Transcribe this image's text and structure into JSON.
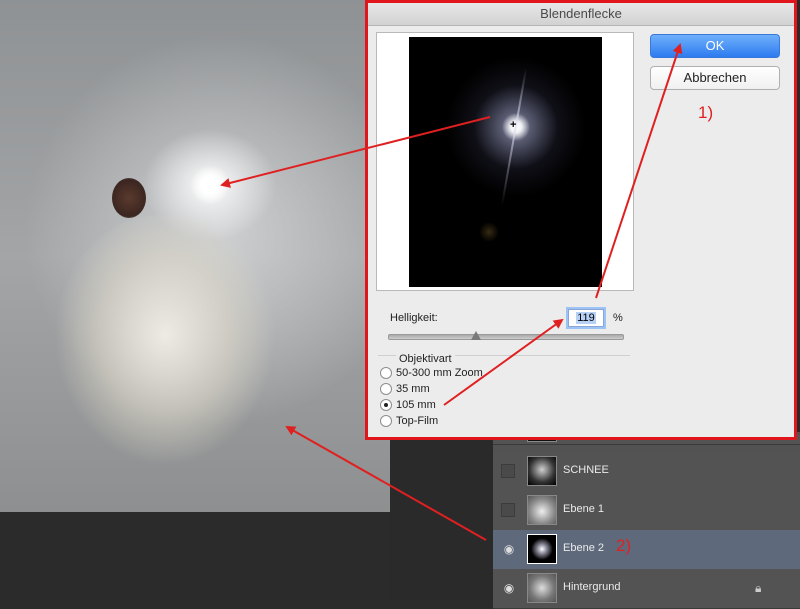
{
  "dialog": {
    "title": "Blendenflecke",
    "ok_label": "OK",
    "cancel_label": "Abbrechen",
    "brightness_label": "Helligkeit:",
    "brightness_value": "119",
    "brightness_percent": 119,
    "percent_sign": "%",
    "lens_type_label": "Objektivart",
    "lens_options": [
      {
        "label": "50-300 mm Zoom",
        "checked": false
      },
      {
        "label": "35 mm",
        "checked": false
      },
      {
        "label": "105 mm",
        "checked": true
      },
      {
        "label": "Top-Film",
        "checked": false
      }
    ],
    "crosshair": "+"
  },
  "annotations": {
    "step1": "1)",
    "step2": "2)",
    "arrow_color": "#e02020"
  },
  "layers": [
    {
      "name": "",
      "visible": false
    },
    {
      "name": "SCHNEE",
      "visible": false
    },
    {
      "name": "Ebene 1",
      "visible": false
    },
    {
      "name": "Ebene 2",
      "visible": true,
      "selected": true
    },
    {
      "name": "Hintergrund",
      "visible": true,
      "locked": true
    }
  ],
  "colors": {
    "dialog_border": "#e1151c",
    "ok_button": "#2d7bf0",
    "selected_layer": "#5e6a7c"
  }
}
